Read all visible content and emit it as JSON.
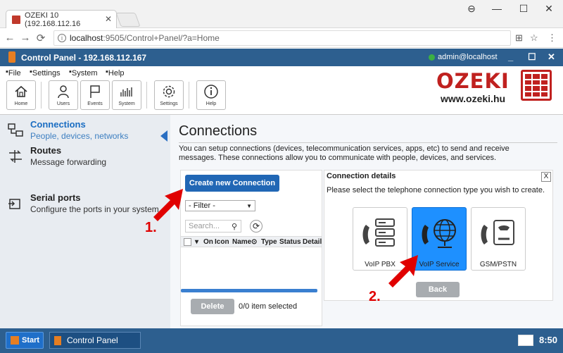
{
  "browser": {
    "tab_title": "OZEKI 10 (192.168.112.16",
    "url_host": "localhost",
    "url_rest": ":9505/Control+Panel/?a=Home"
  },
  "app": {
    "title": "Control Panel - 192.168.112.167",
    "user": "admin@localhost"
  },
  "menu": [
    "File",
    "Settings",
    "System",
    "Help"
  ],
  "toolbar": [
    "Home",
    "Users",
    "Events",
    "System",
    "Settings",
    "Help"
  ],
  "logo": {
    "word": "OZEKI",
    "site": "www.ozeki.hu"
  },
  "sidebar": [
    {
      "title": "Connections",
      "sub": "People, devices, networks"
    },
    {
      "title": "Routes",
      "sub": "Message forwarding"
    },
    {
      "title": "Serial ports",
      "sub": "Configure the ports in your system"
    }
  ],
  "main": {
    "heading": "Connections",
    "description": "You can setup connections (devices, telecommunication services, apps, etc) to send and receive messages. These connections allow you to communicate with people, devices, and services.",
    "create_label": "Create new Connection",
    "filter_label": "- Filter -",
    "search_placeholder": "Search...",
    "columns": [
      "On",
      "Icon",
      "Name",
      "Type",
      "Status",
      "Detail"
    ],
    "delete_label": "Delete",
    "selection_status": "0/0 item selected"
  },
  "details": {
    "title": "Connection details",
    "hint": "Please select the telephone connection type you wish to create.",
    "types": [
      "VoIP PBX",
      "VoIP Service",
      "GSM/PSTN"
    ],
    "selected_type": "VoIP Service",
    "back_label": "Back",
    "close_glyph": "X"
  },
  "annotations": {
    "step1": "1.",
    "step2": "2."
  },
  "taskbar": {
    "start": "Start",
    "item": "Control Panel",
    "clock": "8:50"
  },
  "colors": {
    "accent": "#2d5f8f",
    "brand_red": "#c0211f",
    "selected": "#1e90ff",
    "annotation": "#e00000"
  }
}
